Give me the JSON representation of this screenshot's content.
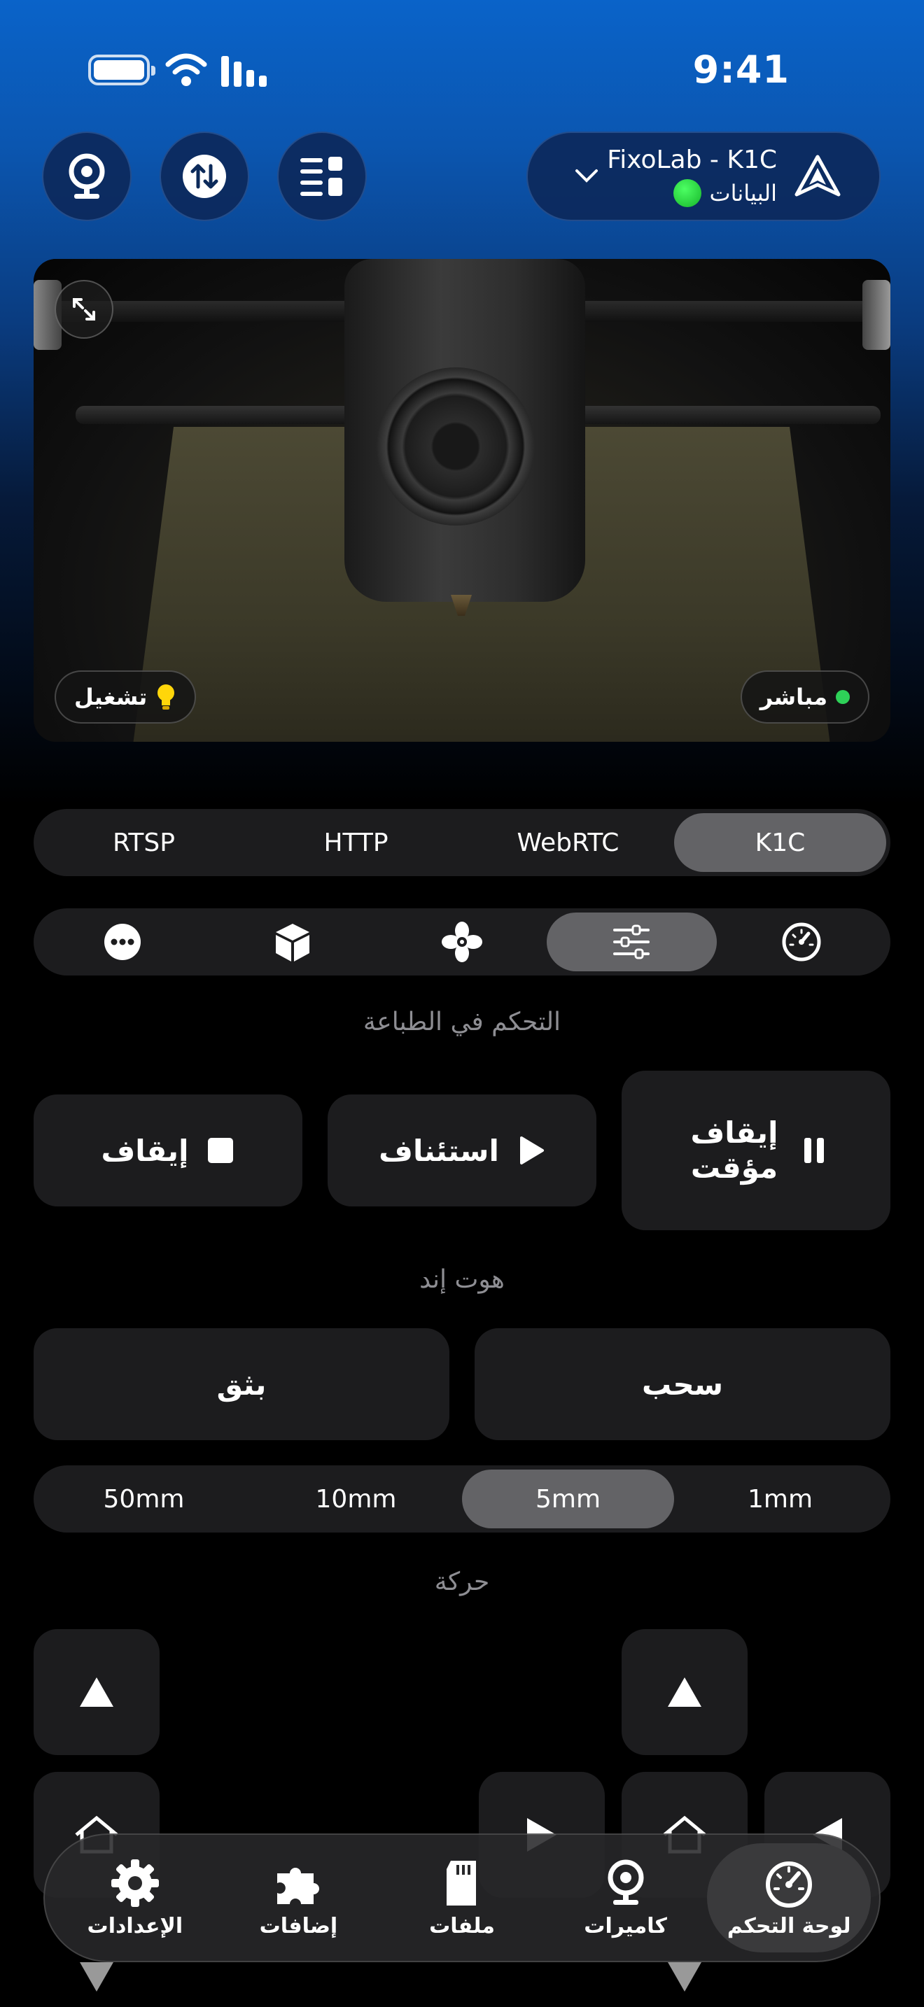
{
  "status_bar": {
    "time": "9:41"
  },
  "header": {
    "printer_name": "FixoLab - K1C",
    "printer_status": "البيانات",
    "status_color": "#2ed13a",
    "buttons": [
      "camera-icon",
      "transfer-icon",
      "list-icon"
    ]
  },
  "camera": {
    "live_label": "مباشر",
    "light_label": "تشغيل",
    "live_color": "#2ed158"
  },
  "stream_tabs": {
    "items": [
      "K1C",
      "WebRTC",
      "HTTP",
      "RTSP"
    ],
    "selected": "K1C"
  },
  "icon_tabs": {
    "items": [
      "gauge-icon",
      "sliders-icon",
      "fan-icon",
      "box-icon",
      "more-icon"
    ],
    "selected": "sliders-icon"
  },
  "printer_control": {
    "title": "التحكم في الطباعة",
    "pause": "إيقاف مؤقت",
    "resume": "استئناف",
    "stop": "إيقاف"
  },
  "hotend": {
    "title": "هوت إند",
    "retract": "سحب",
    "extrude": "بثق",
    "steps": [
      "1mm",
      "5mm",
      "10mm",
      "50mm"
    ],
    "selected_step": "5mm"
  },
  "movement": {
    "title": "حركة"
  },
  "tabbar": {
    "items": [
      {
        "label": "لوحة التحكم",
        "icon": "dashboard-icon"
      },
      {
        "label": "كاميرات",
        "icon": "webcam-icon"
      },
      {
        "label": "ملفات",
        "icon": "sdcard-icon"
      },
      {
        "label": "إضافات",
        "icon": "puzzle-icon"
      },
      {
        "label": "الإعدادات",
        "icon": "gear-icon"
      }
    ],
    "selected": "لوحة التحكم"
  }
}
